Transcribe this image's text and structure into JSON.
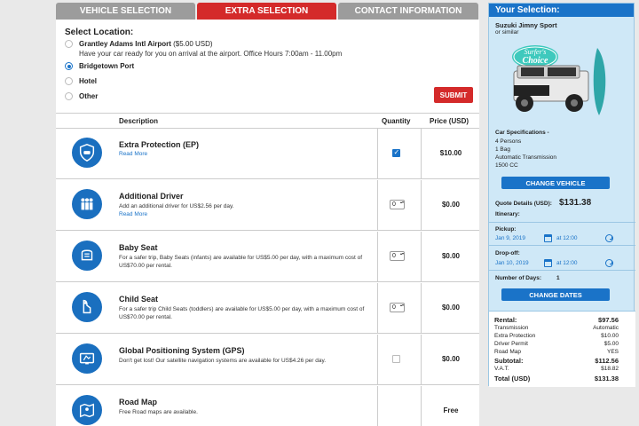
{
  "tabs": [
    {
      "label": "VEHICLE SELECTION"
    },
    {
      "label": "EXTRA SELECTION"
    },
    {
      "label": "CONTACT INFORMATION"
    }
  ],
  "location": {
    "title": "Select Location:",
    "options": [
      {
        "name": "Grantley Adams Intl Airport",
        "price": "($5.00 USD)",
        "desc": "Have your car ready for you on arrival at the airport. Office Hours 7:00am - 11.00pm"
      },
      {
        "name": "Bridgetown Port"
      },
      {
        "name": "Hotel"
      },
      {
        "name": "Other"
      }
    ],
    "submit": "SUBMIT"
  },
  "table": {
    "headers": {
      "description": "Description",
      "quantity": "Quantity",
      "price": "Price (USD)"
    },
    "rows": [
      {
        "name": "Extra Protection (EP)",
        "text": "",
        "more": "Read More",
        "qty": "",
        "checked": true,
        "price": "$10.00"
      },
      {
        "name": "Additional Driver",
        "text": "Add an additional driver for US$2.56 per day.",
        "more": "Read More",
        "qty": "0",
        "price": "$0.00"
      },
      {
        "name": "Baby Seat",
        "text": "For a safer trip, Baby Seats (infants) are available for US$5.00 per day, with a maximum cost of US$70.00 per rental.",
        "more": "",
        "qty": "0",
        "price": "$0.00"
      },
      {
        "name": "Child Seat",
        "text": "For a safer trip Child Seats (toddlers) are available for US$5.00 per day, with a maximum cost of US$70.00 per rental.",
        "more": "",
        "qty": "0",
        "price": "$0.00"
      },
      {
        "name": "Global Positioning System (GPS)",
        "text": "Don't get lost! Our satellite navigation systems are available for US$4.26 per day.",
        "more": "",
        "qty": "",
        "checked": false,
        "price": "$0.00"
      },
      {
        "name": "Road Map",
        "text": "Free Road maps are available.",
        "more": "",
        "qty": "",
        "price": "Free"
      }
    ]
  },
  "side": {
    "title": "Your Selection:",
    "car": "Suzuki Jimny Sport",
    "similar": "or similar",
    "badge_line1": "Surfer's",
    "badge_line2": "Choice",
    "specs_title": "Car Specifications -",
    "specs": [
      "4 Persons",
      "1 Bag",
      "Automatic Transmission",
      "1500 CC"
    ],
    "change_vehicle": "CHANGE VEHICLE",
    "quote_label": "Quote Details (USD):",
    "quote_value": "$131.38",
    "itinerary": "Itinerary:",
    "pickup_label": "Pickup:",
    "pickup_date": "Jan 9, 2019",
    "pickup_time": "at 12:00",
    "dropoff_label": "Drop-off:",
    "dropoff_date": "Jan 10, 2019",
    "dropoff_time": "at 12:00",
    "days_label": "Number of Days:",
    "days_value": "1",
    "change_dates": "CHANGE DATES",
    "summary": [
      {
        "label": "Rental:",
        "value": "$97.56",
        "bold": true
      },
      {
        "label": "Transmission",
        "value": "Automatic"
      },
      {
        "label": "Extra Protection",
        "value": "$10.00"
      },
      {
        "label": "Driver Permit",
        "value": "$5.00"
      },
      {
        "label": "Road Map",
        "value": "YES"
      },
      {
        "label": "Subtotal:",
        "value": "$112.56",
        "bold": true
      },
      {
        "label": "V.A.T.",
        "value": "$18.82"
      },
      {
        "label": "Total (USD)",
        "value": "$131.38",
        "bold": true
      }
    ]
  },
  "colors": {
    "accent": "#1a73c8",
    "red": "#d42a2a",
    "sidebar": "#cfe8f7"
  }
}
